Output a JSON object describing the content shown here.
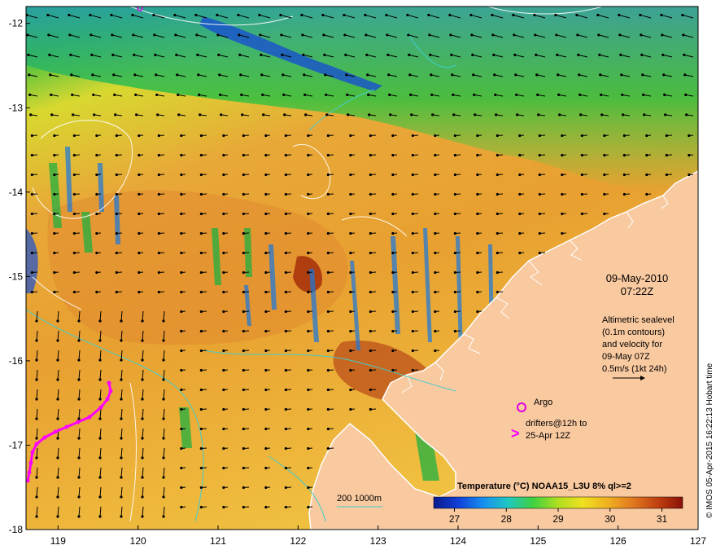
{
  "map": {
    "lon_range": [
      118.6,
      127
    ],
    "lat_range": [
      -18,
      -11.8
    ],
    "lon_ticks": [
      "119",
      "120",
      "121",
      "122",
      "123",
      "124",
      "125",
      "126",
      "127"
    ],
    "lat_ticks": [
      "-12",
      "-13",
      "-14",
      "-15",
      "-16",
      "-17",
      "-18"
    ],
    "land_color": "#f9c9a0",
    "coast_color": "#ffffff"
  },
  "datetime": {
    "date": "09-May-2010",
    "time": "07:22Z"
  },
  "altimetry": {
    "line1": "Altimetric sealevel",
    "line2": "(0.1m contours)",
    "line3": "and velocity for",
    "line4": "09-May 07Z",
    "line5": "0.5m/s (1kt 24h)"
  },
  "legend": {
    "argo_label": "Argo",
    "argo_color": "#e000e0",
    "drifters_line1": "drifters@12h to",
    "drifters_line2": "25-Apr 12Z",
    "drifter_color": "#ff00ff"
  },
  "bathymetry": {
    "label": "200  1000m",
    "color": "#44cccc"
  },
  "colorbar": {
    "title": "Temperature (°C) NOAA15_L3U 8% ql>=2",
    "ticks": [
      "27",
      "28",
      "29",
      "30",
      "31"
    ],
    "range": [
      26.6,
      31.4
    ],
    "colors": [
      "#0a1a8c",
      "#1040d8",
      "#1890f0",
      "#20c8c0",
      "#40d040",
      "#b0e020",
      "#f0e020",
      "#f0b020",
      "#e07820",
      "#c04010",
      "#8a1008"
    ]
  },
  "credit": "© IMOS 05-Apr-2015 16:22:13 Hobart time"
}
